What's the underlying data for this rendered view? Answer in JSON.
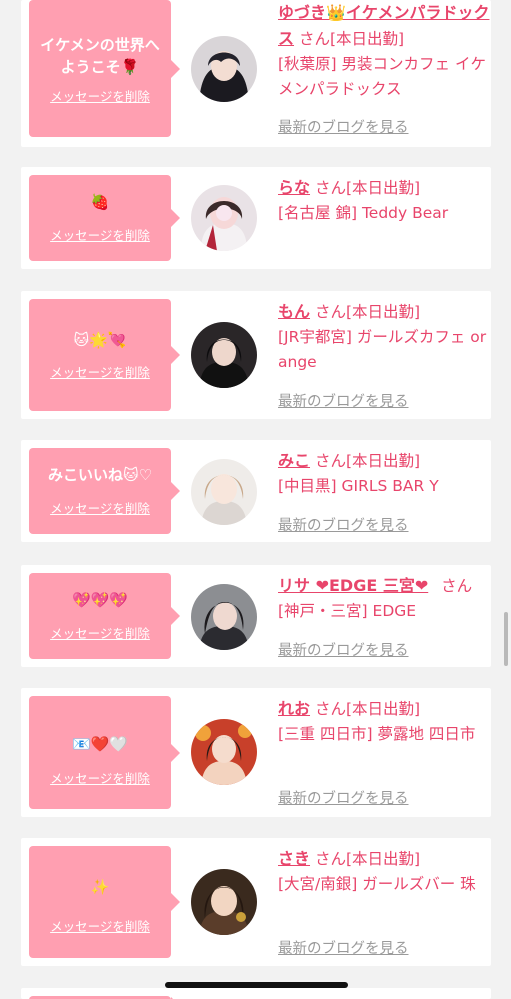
{
  "delete_label": "メッセージを削除",
  "blog_label": "最新のブログを見る",
  "san_suffix": "さん",
  "entries": [
    {
      "message": "イケメンの世界へようこそ🌹",
      "name": "ゆづき👑イケメンパラドックス",
      "status": "[本日出勤]",
      "store": "[秋葉原] 男装コンカフェ イケメンパラドックス",
      "avatar": "avatar-1"
    },
    {
      "message": "🍓",
      "name": "らな",
      "status": "[本日出勤]",
      "store": "[名古屋 錦] Teddy Bear",
      "avatar": "avatar-2"
    },
    {
      "message": "🐱🌟💘",
      "name": "もん",
      "status": "[本日出勤]",
      "store": "[JR宇都宮] ガールズカフェ orange",
      "avatar": "avatar-3"
    },
    {
      "message": "みこいいね🐱♡",
      "name": "みこ",
      "status": "[本日出勤]",
      "store": "[中目黒] GIRLS BAR Y",
      "avatar": "avatar-4"
    },
    {
      "message": "💖💖💖",
      "name": "リサ ❤EDGE 三宮❤",
      "status": "",
      "store": "[神戸・三宮] EDGE",
      "avatar": "avatar-5"
    },
    {
      "message": "📧❤️🤍",
      "name": "れお",
      "status": "[本日出勤]",
      "store": "[三重 四日市] 夢露地 四日市",
      "avatar": "avatar-6"
    },
    {
      "message": "✨",
      "name": "さき",
      "status": "[本日出勤]",
      "store": "[大宮/南銀] ガールズバー 珠",
      "avatar": "avatar-7"
    }
  ],
  "colors": {
    "bubble": "#ff9fb1",
    "accent": "#e8456b",
    "muted": "#9a9a9a",
    "background": "#f2f2f2"
  }
}
